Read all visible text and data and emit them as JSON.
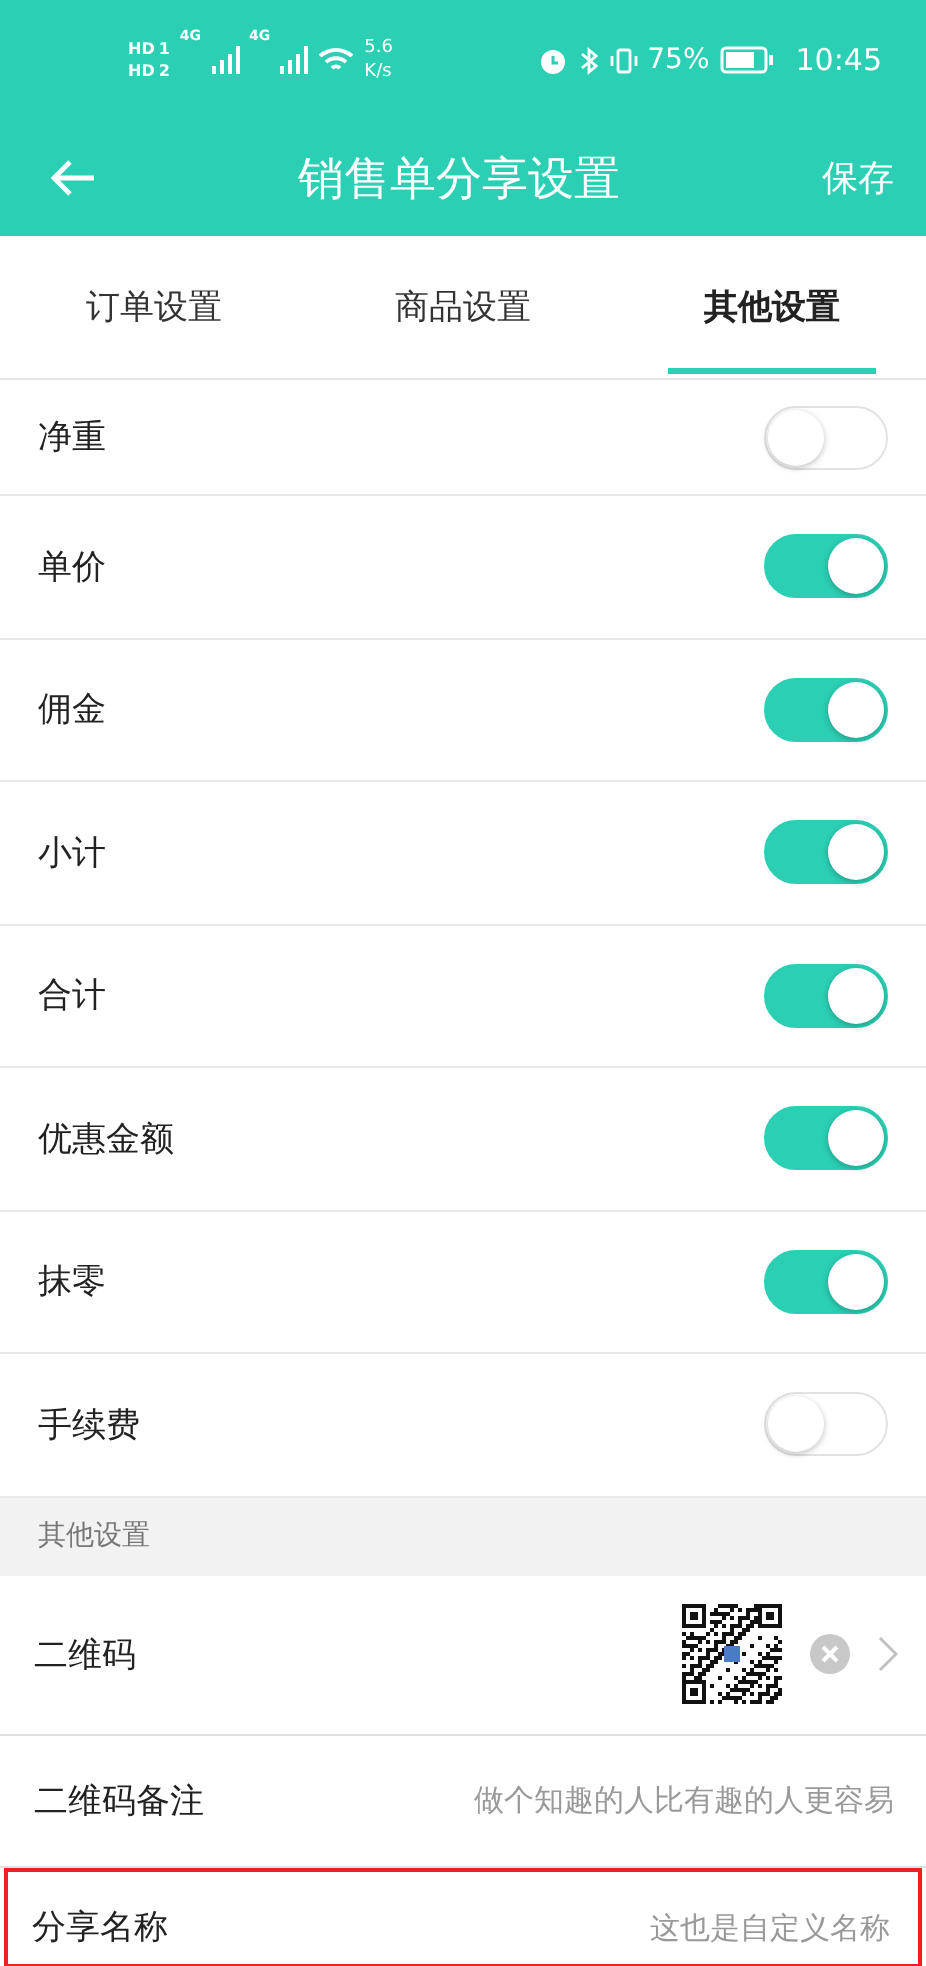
{
  "status_bar": {
    "sim_labels": [
      "HD",
      "1",
      "HD",
      "2"
    ],
    "network_labels": [
      "4G",
      "4G"
    ],
    "speed": "5.6",
    "speed_unit": "K/s",
    "battery": "75%",
    "time": "10:45"
  },
  "header": {
    "title": "销售单分享设置",
    "action": "保存"
  },
  "tabs": [
    {
      "label": "订单设置",
      "selected": false
    },
    {
      "label": "商品设置",
      "selected": false
    },
    {
      "label": "其他设置",
      "selected": true
    }
  ],
  "toggles": [
    {
      "label": "净重",
      "on": false
    },
    {
      "label": "单价",
      "on": true
    },
    {
      "label": "佣金",
      "on": true
    },
    {
      "label": "小计",
      "on": true
    },
    {
      "label": "合计",
      "on": true
    },
    {
      "label": "优惠金额",
      "on": true
    },
    {
      "label": "抹零",
      "on": true
    },
    {
      "label": "手续费",
      "on": false
    }
  ],
  "section": {
    "title": "其他设置"
  },
  "rows": [
    {
      "kind": "qr",
      "label": "二维码"
    },
    {
      "kind": "text",
      "label": "二维码备注",
      "placeholder": "做个知趣的人比有趣的人更容易"
    },
    {
      "kind": "text",
      "label": "分享名称",
      "placeholder": "这也是自定义名称",
      "highlighted": true
    }
  ]
}
